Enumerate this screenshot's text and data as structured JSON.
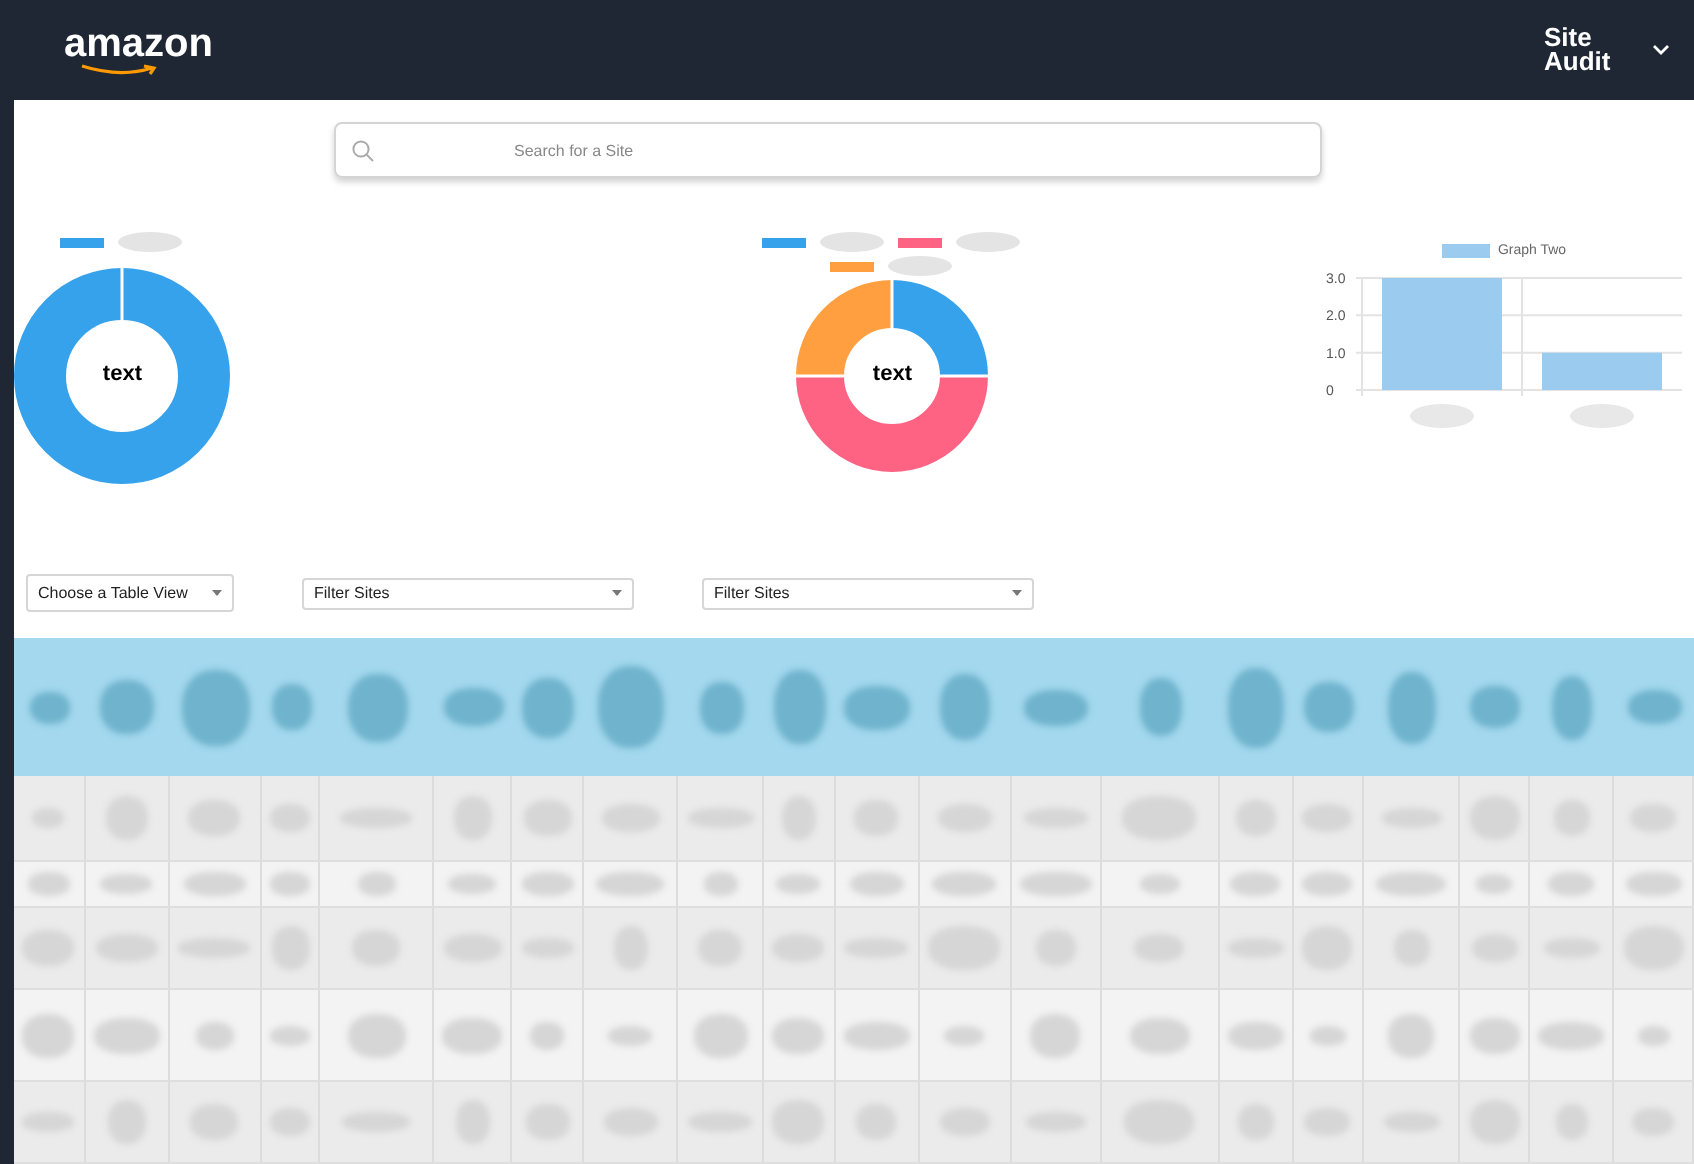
{
  "header": {
    "logo": "amazon",
    "app_title": "Site Audit"
  },
  "search": {
    "placeholder": "Search for a Site"
  },
  "donut_one": {
    "center": "text"
  },
  "donut_two": {
    "center": "text"
  },
  "bar_chart": {
    "chart_data": {
      "type": "bar",
      "series": [
        {
          "name": "Graph Two",
          "color": "#9ccbf0",
          "values": [
            3,
            1
          ]
        }
      ],
      "ylim": [
        0,
        3
      ],
      "yticks": [
        {
          "value": 0,
          "label": "0"
        },
        {
          "value": 1,
          "label": "1.0"
        },
        {
          "value": 2,
          "label": "2.0"
        },
        {
          "value": 3,
          "label": "3.0"
        }
      ]
    }
  },
  "filters": [
    {
      "kind": "small",
      "label": "Choose a Table View"
    },
    {
      "kind": "wide",
      "label": "Filter Sites"
    },
    {
      "kind": "wide",
      "label": "Filter Sites"
    }
  ]
}
